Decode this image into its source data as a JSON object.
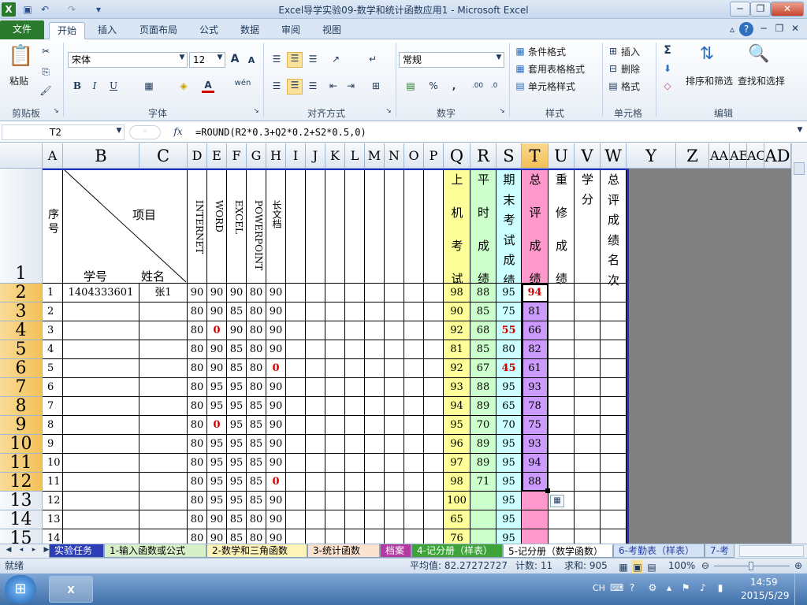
{
  "window": {
    "title": "Excel导学实验09-数学和统计函数应用1 - Microsoft Excel",
    "minimize": "─",
    "restore": "❐",
    "close": "✕"
  },
  "ribbon_tabs": [
    "文件",
    "开始",
    "插入",
    "页面布局",
    "公式",
    "数据",
    "审阅",
    "视图"
  ],
  "home": {
    "clipboard": {
      "paste": "粘贴",
      "label": "剪贴板"
    },
    "font": {
      "name": "宋体",
      "size": "12",
      "label": "字体",
      "bold": "B",
      "italic": "I",
      "underline": "U",
      "grow": "A",
      "shrink": "A",
      "wen": "wén",
      "fontcolor": "A"
    },
    "alignment": {
      "label": "对齐方式"
    },
    "number": {
      "format": "常规",
      "label": "数字",
      "percent": "%",
      "comma": ",",
      "inc": ".00",
      "dec": ".0"
    },
    "styles": {
      "cond": "条件格式",
      "table": "套用表格格式",
      "cell": "单元格样式",
      "label": "样式"
    },
    "cells": {
      "insert": "插入",
      "delete": "删除",
      "format": "格式",
      "label": "单元格"
    },
    "editing": {
      "sum": "Σ",
      "sort": "排序和筛选",
      "find": "查找和选择",
      "label": "编辑"
    }
  },
  "formula_bar": {
    "name_box": "T2",
    "fx": "fx",
    "formula": "=ROUND(R2*0.3+Q2*0.2+S2*0.5,0)"
  },
  "columns": [
    "A",
    "B",
    "C",
    "D",
    "E",
    "F",
    "G",
    "H",
    "I",
    "J",
    "K",
    "L",
    "M",
    "N",
    "O",
    "P",
    "Q",
    "R",
    "S",
    "T",
    "U",
    "V",
    "W",
    "Y",
    "Z",
    "AA",
    "AE",
    "AC",
    "AD"
  ],
  "header_row": {
    "num": "1",
    "seq": "序号",
    "xiangmu": "项目",
    "xuehao": "学号",
    "xingming": "姓名",
    "internet": "INTERNET",
    "word": "WORD",
    "excel": "EXCEL",
    "ppt": "POWERPOINT",
    "long": "长文档",
    "q": [
      "上",
      "机",
      "考",
      "试"
    ],
    "r": [
      "平",
      "时",
      "成",
      "绩"
    ],
    "s": [
      "期",
      "末",
      "考",
      "试",
      "成",
      "绩"
    ],
    "t": [
      "总",
      "评",
      "成",
      "绩"
    ],
    "u": [
      "重",
      "修",
      "成",
      "绩"
    ],
    "v": [
      "学",
      "分"
    ],
    "w": [
      "总",
      "评",
      "成",
      "绩",
      "名",
      "次"
    ]
  },
  "rows": [
    {
      "r": "2",
      "a": "1",
      "b": "1404333601",
      "c": "张1",
      "d": "90",
      "e": "90",
      "f": "90",
      "g": "80",
      "h": "90",
      "q": "98",
      "rv": "88",
      "s": "95",
      "t": "94",
      "red": [
        "t"
      ]
    },
    {
      "r": "3",
      "a": "2",
      "b": "",
      "c": "",
      "d": "80",
      "e": "90",
      "f": "85",
      "g": "80",
      "h": "90",
      "q": "90",
      "rv": "85",
      "s": "75",
      "t": "81",
      "red": []
    },
    {
      "r": "4",
      "a": "3",
      "b": "",
      "c": "",
      "d": "80",
      "e": "0",
      "f": "90",
      "g": "80",
      "h": "90",
      "q": "92",
      "rv": "68",
      "s": "55",
      "t": "66",
      "red": [
        "e",
        "s"
      ]
    },
    {
      "r": "5",
      "a": "4",
      "b": "",
      "c": "",
      "d": "80",
      "e": "90",
      "f": "85",
      "g": "80",
      "h": "90",
      "q": "81",
      "rv": "85",
      "s": "80",
      "t": "82",
      "red": []
    },
    {
      "r": "6",
      "a": "5",
      "b": "",
      "c": "",
      "d": "80",
      "e": "90",
      "f": "85",
      "g": "80",
      "h": "0",
      "q": "92",
      "rv": "67",
      "s": "45",
      "t": "61",
      "red": [
        "h",
        "s"
      ]
    },
    {
      "r": "7",
      "a": "6",
      "b": "",
      "c": "",
      "d": "80",
      "e": "95",
      "f": "95",
      "g": "80",
      "h": "90",
      "q": "93",
      "rv": "88",
      "s": "95",
      "t": "93",
      "red": []
    },
    {
      "r": "8",
      "a": "7",
      "b": "",
      "c": "",
      "d": "80",
      "e": "95",
      "f": "95",
      "g": "85",
      "h": "90",
      "q": "94",
      "rv": "89",
      "s": "65",
      "t": "78",
      "red": []
    },
    {
      "r": "9",
      "a": "8",
      "b": "",
      "c": "",
      "d": "80",
      "e": "0",
      "f": "95",
      "g": "85",
      "h": "90",
      "q": "95",
      "rv": "70",
      "s": "70",
      "t": "75",
      "red": [
        "e"
      ]
    },
    {
      "r": "10",
      "a": "9",
      "b": "",
      "c": "",
      "d": "80",
      "e": "95",
      "f": "95",
      "g": "85",
      "h": "90",
      "q": "96",
      "rv": "89",
      "s": "95",
      "t": "93",
      "red": []
    },
    {
      "r": "11",
      "a": "10",
      "b": "",
      "c": "",
      "d": "80",
      "e": "95",
      "f": "95",
      "g": "85",
      "h": "90",
      "q": "97",
      "rv": "89",
      "s": "95",
      "t": "94",
      "red": []
    },
    {
      "r": "12",
      "a": "11",
      "b": "",
      "c": "",
      "d": "80",
      "e": "95",
      "f": "95",
      "g": "85",
      "h": "0",
      "q": "98",
      "rv": "71",
      "s": "95",
      "t": "88",
      "red": [
        "h"
      ]
    },
    {
      "r": "13",
      "a": "12",
      "b": "",
      "c": "",
      "d": "80",
      "e": "95",
      "f": "95",
      "g": "85",
      "h": "90",
      "q": "100",
      "rv": "",
      "s": "95",
      "t": "",
      "red": []
    },
    {
      "r": "14",
      "a": "13",
      "b": "",
      "c": "",
      "d": "80",
      "e": "90",
      "f": "85",
      "g": "80",
      "h": "90",
      "q": "65",
      "rv": "",
      "s": "95",
      "t": "",
      "red": []
    },
    {
      "r": "15",
      "a": "14",
      "b": "",
      "c": "",
      "d": "80",
      "e": "90",
      "f": "85",
      "g": "80",
      "h": "90",
      "q": "76",
      "rv": "",
      "s": "95",
      "t": "",
      "red": []
    }
  ],
  "sheet_tabs": [
    "实验任务",
    "1-输入函数或公式",
    "2-数学和三角函数",
    "3-统计函数",
    "档案",
    "4-记分册（样表）",
    "5-记分册（数学函数）",
    "6-考勤表（样表）",
    "7-考"
  ],
  "status": {
    "ready": "就绪",
    "average": "平均值: 82.27272727",
    "count": "计数: 11",
    "sum": "求和: 905",
    "zoom": "100%"
  },
  "taskbar": {
    "lang": "CH",
    "time": "14:59",
    "date": "2015/5/29"
  },
  "colors": {
    "accent_green": "#2a7a2e",
    "selected_header": "#f3c056",
    "col_q": "#ffff99",
    "col_r": "#ccffcc",
    "col_s": "#ccffff",
    "col_t_head": "#ff99cc",
    "col_t_vals": "#cc99ff"
  }
}
